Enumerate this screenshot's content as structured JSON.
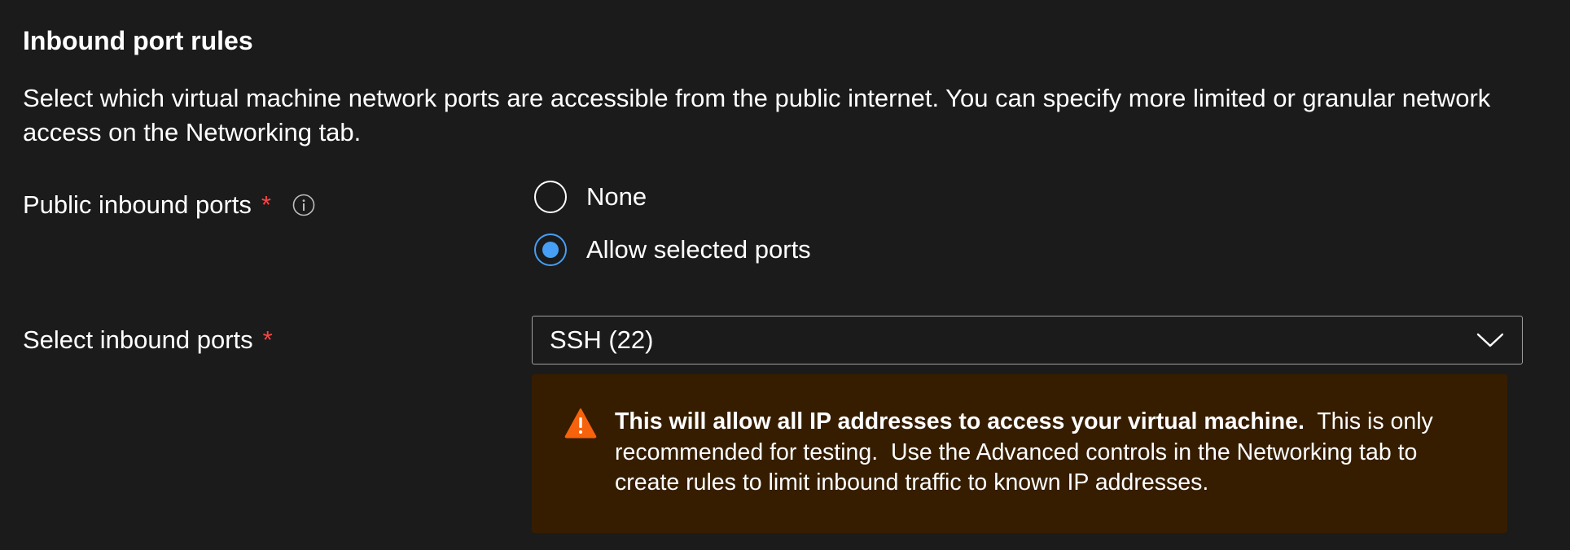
{
  "section": {
    "title": "Inbound port rules",
    "description": "Select which virtual machine network ports are accessible from the public internet. You can specify more limited or granular network access on the Networking tab."
  },
  "public_ports": {
    "label": "Public inbound ports",
    "required_mark": "*",
    "options": [
      {
        "label": "None",
        "selected": false
      },
      {
        "label": "Allow selected ports",
        "selected": true
      }
    ]
  },
  "select_ports": {
    "label": "Select inbound ports",
    "required_mark": "*",
    "value": "SSH (22)"
  },
  "warning": {
    "bold_text": "This will allow all IP addresses to access your virtual machine.",
    "text": "  This is only recommended for testing.  Use the Advanced controls in the Networking tab to create rules to limit inbound traffic to known IP addresses."
  },
  "icons": {
    "info": "info-icon",
    "chevron": "chevron-down-icon",
    "warning": "warning-icon"
  },
  "colors": {
    "background": "#1b1b1b",
    "required": "#ff4343",
    "radio_selected": "#479ef5",
    "warning_background": "#361d00",
    "warning_icon": "#f7630c"
  }
}
